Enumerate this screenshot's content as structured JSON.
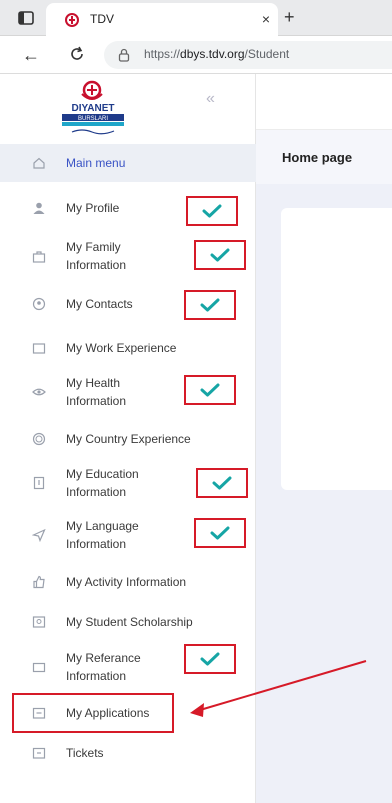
{
  "browser": {
    "tab_title": "TDV",
    "new_tab_glyph": "+",
    "close_glyph": "×",
    "back_glyph": "←",
    "url_prefix": "https://",
    "url_domain": "dbys.tdv.org",
    "url_path": "/Student"
  },
  "sidebar": {
    "collapse_glyph": "«",
    "items": [
      {
        "label": "Main menu",
        "icon": "home-icon",
        "active": true,
        "checked": false
      },
      {
        "label": "My Profile",
        "icon": "user-icon",
        "checked": true
      },
      {
        "label": "My Family\nInformation",
        "icon": "family-icon",
        "checked": true
      },
      {
        "label": "My Contacts",
        "icon": "contacts-icon",
        "checked": true
      },
      {
        "label": "My Work Experience",
        "icon": "briefcase-icon",
        "checked": false
      },
      {
        "label": "My Health\nInformation",
        "icon": "eye-icon",
        "checked": true
      },
      {
        "label": "My Country Experience",
        "icon": "globe-icon",
        "checked": false
      },
      {
        "label": "My Education\nInformation",
        "icon": "book-icon",
        "checked": true
      },
      {
        "label": "My Language\nInformation",
        "icon": "send-icon",
        "checked": true
      },
      {
        "label": "My Activity Information",
        "icon": "thumbs-up-icon",
        "checked": false
      },
      {
        "label": "My Student Scholarship",
        "icon": "certificate-icon",
        "checked": false
      },
      {
        "label": "My Referance\nInformation",
        "icon": "id-card-icon",
        "checked": true
      },
      {
        "label": "My Applications",
        "icon": "folder-icon",
        "checked": false
      },
      {
        "label": "Tickets",
        "icon": "ticket-icon",
        "checked": false
      }
    ]
  },
  "main": {
    "page_title": "Home page"
  },
  "colors": {
    "accent": "#3a53c5",
    "annotation_red": "#d61a28",
    "check_teal": "#16a5a5"
  }
}
